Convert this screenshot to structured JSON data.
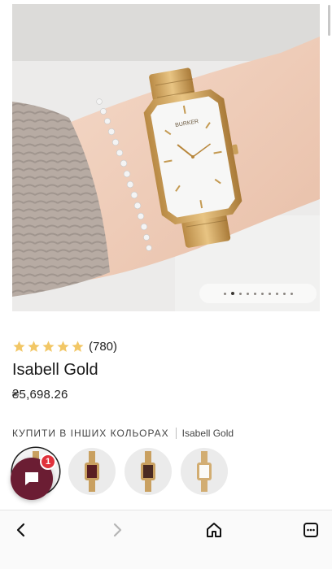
{
  "product": {
    "rating_count": "(780)",
    "stars": 5,
    "title": "Isabell Gold",
    "price": "₴5,698.26",
    "image_brand": "BURKER"
  },
  "gallery": {
    "total_images": 10,
    "active_index": 1
  },
  "colors": {
    "section_title": "КУПИТИ В ІНШИХ КОЛЬОРАХ",
    "current": "Isabell Gold",
    "swatch_count": 4
  },
  "chat": {
    "badge": "1"
  },
  "browser_nav": {
    "buttons": [
      "back",
      "forward",
      "home",
      "tabs"
    ]
  },
  "colors_palette": {
    "star": "#f2c766",
    "chat_bg": "#6b1d33",
    "badge": "#e0313b"
  }
}
